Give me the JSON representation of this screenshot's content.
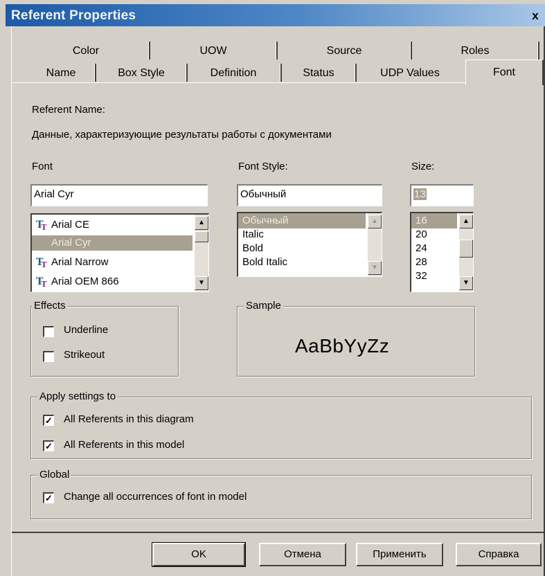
{
  "window": {
    "title": "Referent Properties",
    "close_label": "x"
  },
  "tabs": {
    "row_back": [
      "Color",
      "UOW",
      "Source",
      "Roles"
    ],
    "row_front": [
      "Name",
      "Box Style",
      "Definition",
      "Status",
      "UDP Values",
      "Font"
    ],
    "active": "Font"
  },
  "referent": {
    "label": "Referent Name:",
    "value": "Данные, характеризующие результаты работы с документами"
  },
  "font": {
    "label": "Font",
    "value": "Arial Cyr",
    "list": [
      "Arial CE",
      "Arial Cyr",
      "Arial Narrow",
      "Arial OEM 866"
    ],
    "selected": "Arial Cyr",
    "icon": "truetype-font-icon"
  },
  "font_style": {
    "label": "Font Style:",
    "value": "Обычный",
    "list": [
      "Обычный",
      "Italic",
      "Bold",
      "Bold Italic"
    ],
    "selected": "Обычный"
  },
  "size": {
    "label": "Size:",
    "value": "13",
    "list": [
      "16",
      "20",
      "24",
      "28",
      "32"
    ],
    "selected": "16"
  },
  "effects": {
    "title": "Effects",
    "underline_label": "Underline",
    "underline_checked": false,
    "strikeout_label": "Strikeout",
    "strikeout_checked": false
  },
  "sample": {
    "title": "Sample",
    "text": "AaBbYyZz"
  },
  "apply": {
    "title": "Apply settings to",
    "diagram_label": "All Referents in this diagram",
    "diagram_checked": true,
    "model_label": "All Referents in this model",
    "model_checked": true
  },
  "global": {
    "title": "Global",
    "change_label": "Change all occurrences of font in model",
    "change_checked": true
  },
  "buttons": {
    "ok": "OK",
    "cancel": "Отмена",
    "apply": "Применить",
    "help": "Справка"
  },
  "colors": {
    "dialog_bg": "#d4d0c8",
    "titlebar_start": "#1c5aa8",
    "selection": "#a8a090"
  }
}
